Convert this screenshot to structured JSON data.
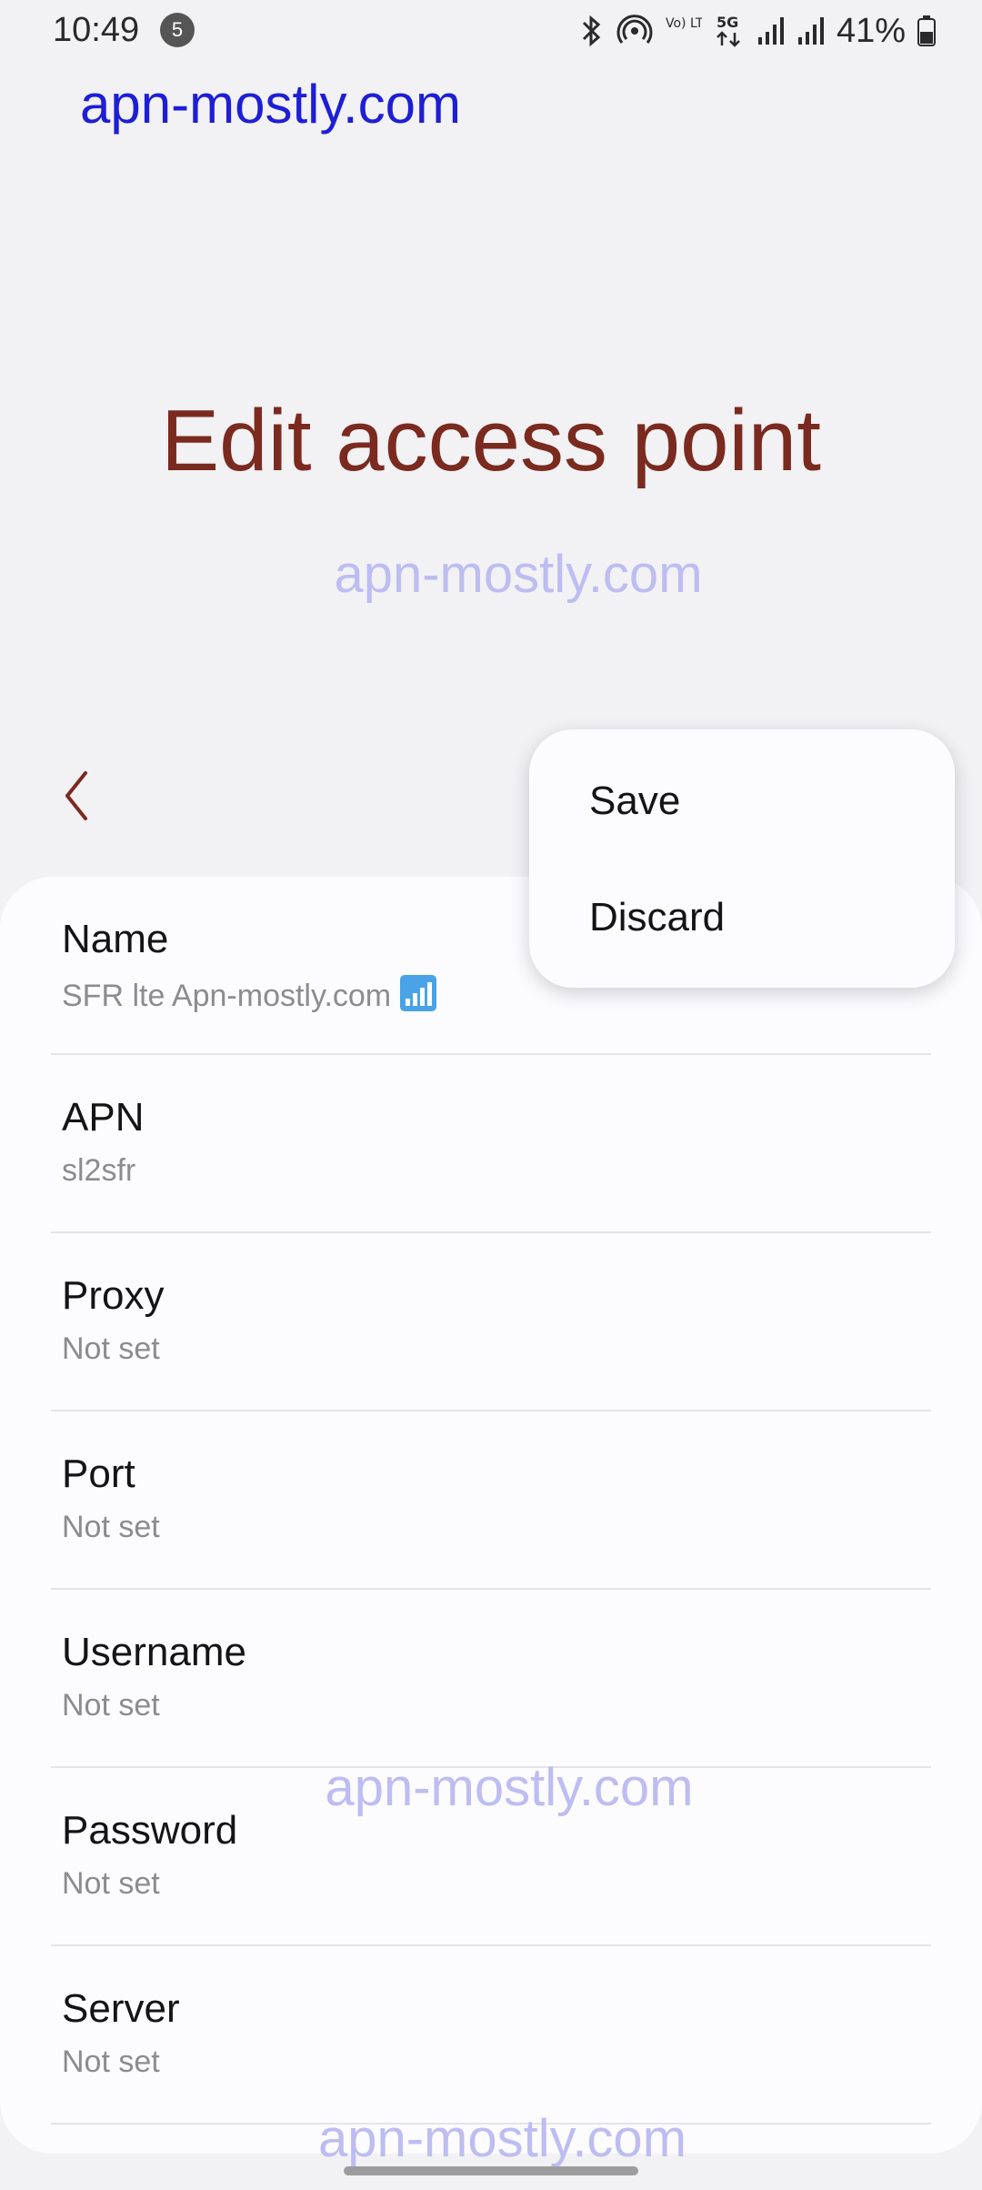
{
  "status_bar": {
    "time": "10:49",
    "notification_count": "5",
    "icons": [
      "bluetooth-icon",
      "hotspot-icon",
      "volte-icon",
      "5g-icon",
      "signal-icon",
      "signal-icon",
      "battery-icon"
    ],
    "volte_label": "Vo) LTE1",
    "network_label": "5G",
    "battery_percent": "41%"
  },
  "watermark": "apn-mostly.com",
  "header": {
    "title": "Edit access point"
  },
  "menu": {
    "save_label": "Save",
    "discard_label": "Discard"
  },
  "fields": [
    {
      "label": "Name",
      "value": "SFR lte Apn-mostly.com"
    },
    {
      "label": "APN",
      "value": "sl2sfr"
    },
    {
      "label": "Proxy",
      "value": "Not set"
    },
    {
      "label": "Port",
      "value": "Not set"
    },
    {
      "label": "Username",
      "value": "Not set"
    },
    {
      "label": "Password",
      "value": "Not set"
    },
    {
      "label": "Server",
      "value": "Not set"
    }
  ],
  "colors": {
    "title": "#7a2a1f",
    "watermark_top": "#1d1ed6",
    "watermark_faint": "#bdbdf2"
  }
}
